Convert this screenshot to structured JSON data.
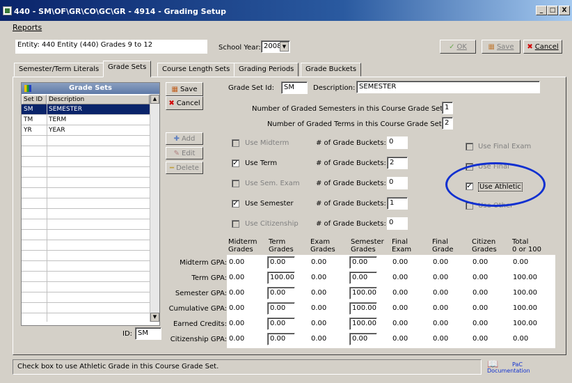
{
  "window": {
    "title": "440 - SM\\OF\\GR\\CO\\GC\\GR - 4914 - Grading Setup",
    "min": "_",
    "max": "□",
    "close": "X"
  },
  "menu": {
    "reports": "Reports"
  },
  "entity": {
    "label": "Entity:",
    "value": "440    Entity (440) Grades 9 to 12"
  },
  "school_year": {
    "label": "School Year:",
    "value": "2008"
  },
  "top_buttons": {
    "ok": "OK",
    "save": "Save",
    "cancel": "Cancel"
  },
  "tabs": [
    "Semester/Term Literals",
    "Grade Sets",
    "Course Length Sets",
    "Grading Periods",
    "Grade Buckets"
  ],
  "grade_sets": {
    "title": "Grade Sets",
    "col_setid": "Set ID",
    "col_desc": "Description",
    "rows": [
      {
        "id": "SM",
        "desc": "SEMESTER"
      },
      {
        "id": "TM",
        "desc": "TERM"
      },
      {
        "id": "YR",
        "desc": "YEAR"
      }
    ]
  },
  "side_buttons": {
    "save": "Save",
    "cancel": "Cancel",
    "add": "Add",
    "edit": "Edit",
    "delete": "Delete"
  },
  "id_field": {
    "label": "ID:",
    "value": "SM"
  },
  "form": {
    "set_id_label": "Grade Set Id:",
    "set_id": "SM",
    "desc_label": "Description:",
    "desc": "SEMESTER",
    "num_sem_label": "Number of Graded Semesters in this Course Grade Set:",
    "num_sem": "1",
    "num_term_label": "Number of Graded Terms in this Course Grade Set:",
    "num_term": "2"
  },
  "options": [
    {
      "label": "Use Midterm",
      "checked": false,
      "enabled": false,
      "buckets_label": "# of Grade Buckets:",
      "buckets": "0"
    },
    {
      "label": "Use Term",
      "checked": true,
      "enabled": true,
      "buckets_label": "# of Grade Buckets:",
      "buckets": "2"
    },
    {
      "label": "Use Sem. Exam",
      "checked": false,
      "enabled": false,
      "buckets_label": "# of Grade Buckets:",
      "buckets": "0"
    },
    {
      "label": "Use Semester",
      "checked": true,
      "enabled": true,
      "buckets_label": "# of Grade Buckets:",
      "buckets": "1"
    },
    {
      "label": "Use Citizenship",
      "checked": false,
      "enabled": false,
      "buckets_label": "# of Grade Buckets:",
      "buckets": "0"
    }
  ],
  "right_options": [
    {
      "label": "Use Final Exam",
      "checked": false,
      "enabled": false
    },
    {
      "label": "Use Final",
      "checked": false,
      "enabled": false
    },
    {
      "label": "Use Athletic",
      "checked": true,
      "enabled": true
    },
    {
      "label": "Use Other",
      "checked": false,
      "enabled": false
    }
  ],
  "gpa_table": {
    "headers": [
      [
        "Midterm",
        "Grades"
      ],
      [
        "Term",
        "Grades"
      ],
      [
        "Exam",
        "Grades"
      ],
      [
        "Semester",
        "Grades"
      ],
      [
        "Final",
        "Exam"
      ],
      [
        "Final",
        "Grade"
      ],
      [
        "Citizen",
        "Grades"
      ],
      [
        "Total",
        "0 or 100"
      ]
    ],
    "rows": [
      {
        "label": "Midterm GPA:",
        "values": [
          "0.00",
          "0.00",
          "0.00",
          "0.00",
          "0.00",
          "0.00",
          "0.00",
          "0.00"
        ]
      },
      {
        "label": "Term GPA:",
        "values": [
          "0.00",
          "100.00",
          "0.00",
          "0.00",
          "0.00",
          "0.00",
          "0.00",
          "100.00"
        ]
      },
      {
        "label": "Semester GPA:",
        "values": [
          "0.00",
          "0.00",
          "0.00",
          "100.00",
          "0.00",
          "0.00",
          "0.00",
          "100.00"
        ]
      },
      {
        "label": "Cumulative GPA:",
        "values": [
          "0.00",
          "0.00",
          "0.00",
          "100.00",
          "0.00",
          "0.00",
          "0.00",
          "100.00"
        ]
      },
      {
        "label": "Earned Credits:",
        "values": [
          "0.00",
          "0.00",
          "0.00",
          "100.00",
          "0.00",
          "0.00",
          "0.00",
          "100.00"
        ]
      },
      {
        "label": "Citizenship GPA:",
        "values": [
          "0.00",
          "0.00",
          "0.00",
          "0.00",
          "0.00",
          "0.00",
          "0.00",
          "0.00"
        ]
      }
    ]
  },
  "status": "Check box to use Athletic Grade in this Course Grade Set.",
  "doc": {
    "line1": "PaC",
    "line2": "Documentation"
  },
  "colors": {
    "highlight_oval": "#1030d0",
    "selection": "#0a246a"
  }
}
